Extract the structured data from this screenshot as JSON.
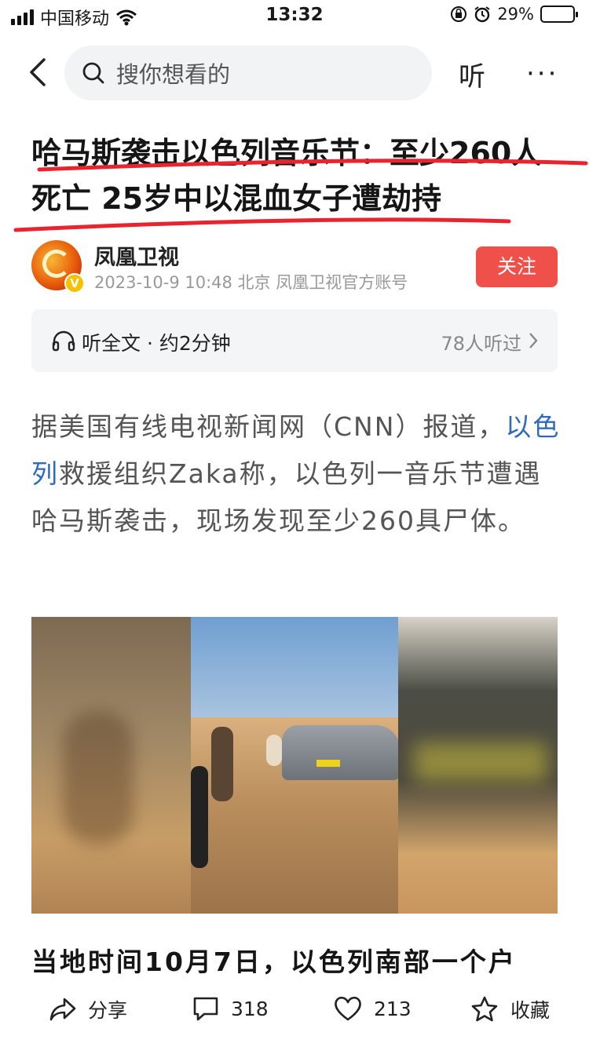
{
  "status_bar": {
    "carrier": "中国移动",
    "time": "13:32",
    "battery": "29%",
    "battery_level": 0.29,
    "icons": [
      "signal-icon",
      "wifi-icon",
      "orientation-lock-icon",
      "alarm-icon",
      "battery-charging-icon"
    ]
  },
  "nav": {
    "search_placeholder": "搜你想看的",
    "listen_label": "听",
    "more_label": "···"
  },
  "article": {
    "title": "哈马斯袭击以色列音乐节：至少260人死亡 25岁中以混血女子遭劫持",
    "author": {
      "name": "凤凰卫视",
      "meta": "2023-10-9  10:48  北京  凤凰卫视官方账号",
      "follow_label": "关注"
    },
    "listen_bar": {
      "label": "听全文 · 约2分钟",
      "count": "78人听过"
    },
    "paragraph": {
      "part1": "据美国有线电视新闻网（CNN）报道，",
      "link": "以色列",
      "part2": "救援组织Zaka称，以色列一音乐节遭遇哈马斯袭击，现场发现至少260具尸体。"
    },
    "subhead": "当地时间10月7日，以色列南部一个户"
  },
  "bottom_bar": {
    "share_label": "分享",
    "comments_count": "318",
    "likes_count": "213",
    "favorite_label": "收藏"
  },
  "colors": {
    "follow_button": "#f0504a",
    "link": "#2f6bbd",
    "underline_marker": "#e8242f"
  }
}
